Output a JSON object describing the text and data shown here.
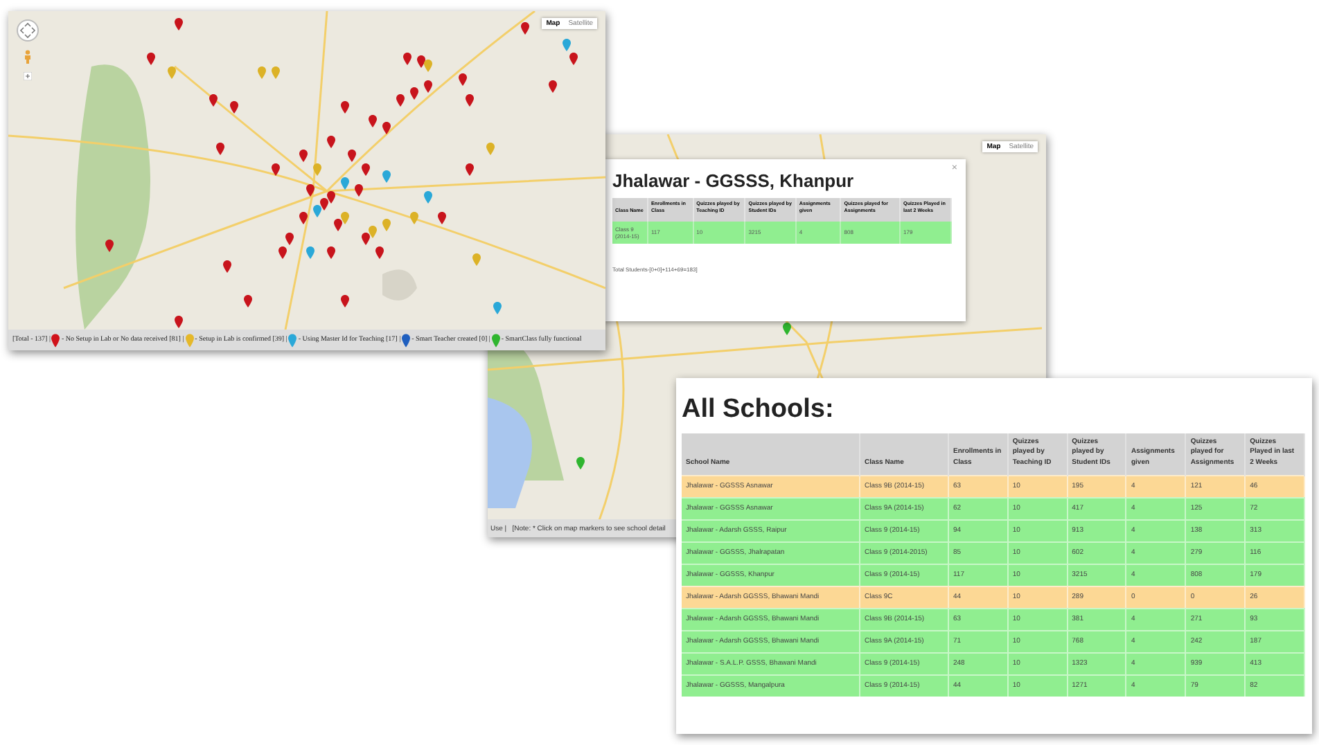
{
  "overview_map": {
    "map_type_buttons": [
      {
        "label": "Map",
        "selected": true
      },
      {
        "label": "Satellite",
        "selected": false
      }
    ],
    "legend": {
      "total": "[Total - 137] |",
      "items": [
        {
          "label": "- No Setup in Lab or No data received [81] |",
          "color": "#d0121b"
        },
        {
          "label": "- Setup in Lab is confirmed [39] |",
          "color": "#e5b82a"
        },
        {
          "label": "- Using Master Id for Teaching [17] |",
          "color": "#2aa8d8"
        },
        {
          "label": "- Smart Teacher created [0] |",
          "color": "#1f5fbf"
        },
        {
          "label": "- SmartClass fully functional",
          "color": "#2fb52f"
        }
      ]
    }
  },
  "school_map": {
    "map_type_buttons": [
      {
        "label": "Map",
        "selected": true
      },
      {
        "label": "Satellite",
        "selected": false
      }
    ],
    "popup": {
      "title": "Jhalawar - GGSSS, Khanpur",
      "close": "×",
      "columns": [
        "Class Name",
        "Enrollments in Class",
        "Quizzes played by Teaching ID",
        "Quizzes played by Student IDs",
        "Assignments given",
        "Quizzes played for Assignments",
        "Quizzes Played in last 2 Weeks"
      ],
      "rows": [
        {
          "color": "#90ee90",
          "cells": [
            "Class 9 (2014-15)",
            "117",
            "10",
            "3215",
            "4",
            "808",
            "179"
          ]
        }
      ],
      "total": "Total Students-[0+0]+114+69=183]"
    },
    "footer": "Use |   [Note: * Click on map markers to see school detail"
  },
  "all_schools": {
    "title": "All Schools:",
    "columns": [
      "School Name",
      "Class Name",
      "Enrollments in Class",
      "Quizzes played by Teaching ID",
      "Quizzes played by Student IDs",
      "Assignments given",
      "Quizzes played for Assignments",
      "Quizzes Played in last 2 Weeks"
    ],
    "rows": [
      {
        "color": "#fcd895",
        "cells": [
          "Jhalawar - GGSSS Asnawar",
          "Class 9B (2014-15)",
          "63",
          "10",
          "195",
          "4",
          "121",
          "46"
        ]
      },
      {
        "color": "#90ee90",
        "cells": [
          "Jhalawar - GGSSS Asnawar",
          "Class 9A (2014-15)",
          "62",
          "10",
          "417",
          "4",
          "125",
          "72"
        ]
      },
      {
        "color": "#90ee90",
        "cells": [
          "Jhalawar - Adarsh GSSS, Raipur",
          "Class 9 (2014-15)",
          "94",
          "10",
          "913",
          "4",
          "138",
          "313"
        ]
      },
      {
        "color": "#90ee90",
        "cells": [
          "Jhalawar - GGSSS, Jhalrapatan",
          "Class 9 (2014-2015)",
          "85",
          "10",
          "602",
          "4",
          "279",
          "116"
        ]
      },
      {
        "color": "#90ee90",
        "cells": [
          "Jhalawar - GGSSS, Khanpur",
          "Class 9 (2014-15)",
          "117",
          "10",
          "3215",
          "4",
          "808",
          "179"
        ]
      },
      {
        "color": "#fcd895",
        "cells": [
          "Jhalawar - Adarsh GGSSS, Bhawani Mandi",
          "Class 9C",
          "44",
          "10",
          "289",
          "0",
          "0",
          "26"
        ]
      },
      {
        "color": "#90ee90",
        "cells": [
          "Jhalawar - Adarsh GGSSS, Bhawani Mandi",
          "Class 9B (2014-15)",
          "63",
          "10",
          "381",
          "4",
          "271",
          "93"
        ]
      },
      {
        "color": "#90ee90",
        "cells": [
          "Jhalawar - Adarsh GGSSS, Bhawani Mandi",
          "Class 9A (2014-15)",
          "71",
          "10",
          "768",
          "4",
          "242",
          "187"
        ]
      },
      {
        "color": "#90ee90",
        "cells": [
          "Jhalawar - S.A.L.P. GSSS, Bhawani Mandi",
          "Class 9 (2014-15)",
          "248",
          "10",
          "1323",
          "4",
          "939",
          "413"
        ]
      },
      {
        "color": "#90ee90",
        "cells": [
          "Jhalawar - GGSSS, Mangalpura",
          "Class 9 (2014-15)",
          "44",
          "10",
          "1271",
          "4",
          "79",
          "82"
        ]
      }
    ]
  }
}
